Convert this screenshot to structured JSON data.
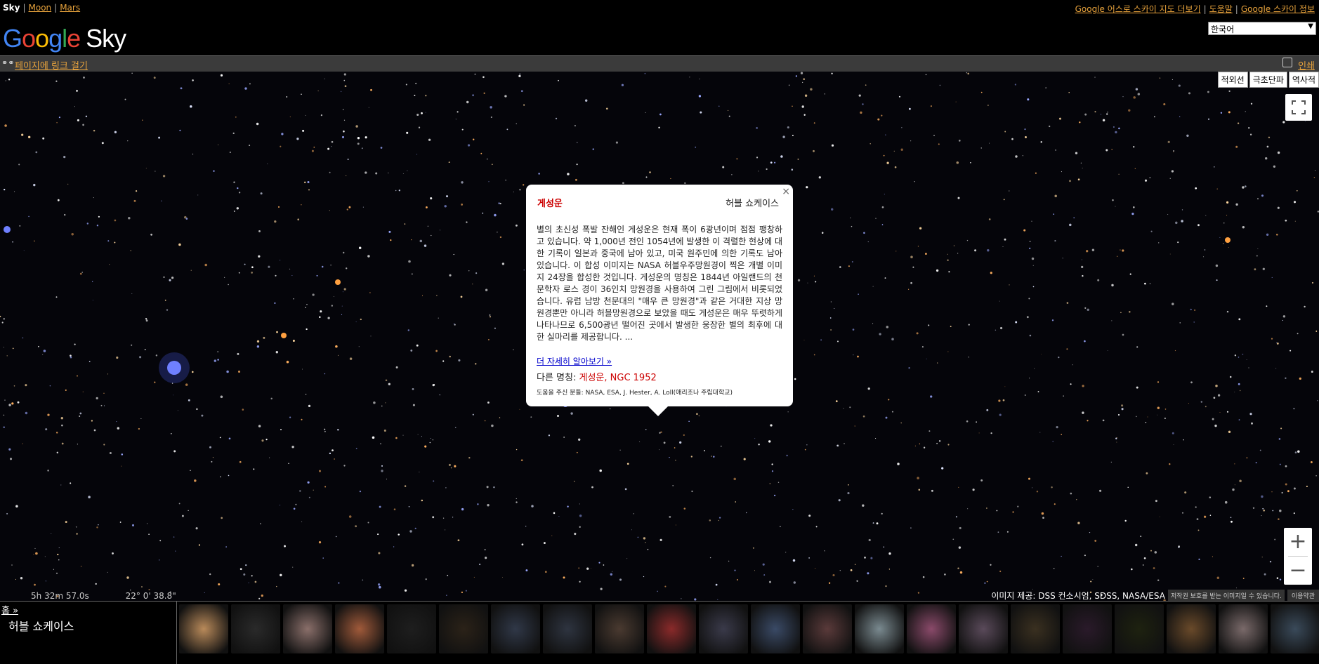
{
  "topbar": {
    "current": "Sky",
    "nav": [
      "Moon",
      "Mars"
    ],
    "links": [
      "Google 어스로 스카이 지도 더보기",
      "도움말",
      "Google 스카이 정보"
    ]
  },
  "header": {
    "logo_word": "Google",
    "logo_product": "Sky",
    "language": "한국어"
  },
  "linkbar": {
    "link_label": "페이지에 링크 걸기",
    "print_label": "인쇄"
  },
  "map": {
    "layers": [
      "적외선",
      "극초단파",
      "역사적"
    ],
    "zoom_in": "+",
    "zoom_out": "−",
    "ra": "5h 32m 57.0s",
    "dec": "22° 0' 38.8\"",
    "credit": "이미지 제공: DSS 컨소시엄, SDSS, NASA/ESA",
    "rights": "저작권 보호를 받는 이미지일 수 있습니다.",
    "terms": "이용약관"
  },
  "popup": {
    "close": "×",
    "title": "게성운",
    "collection": "허블 쇼케이스",
    "description": "별의 초신성 폭발 잔해인 게성운은 현재 폭이 6광년이며 점점 팽창하고 있습니다. 약 1,000년 전인 1054년에 발생한 이 격렬한 현상에 대한 기록이 일본과 중국에 남아 있고, 미국 원주민에 의한 기록도 남아 있습니다. 이 합성 이미지는 NASA 허블우주망원경이 찍은 개별 이미지 24장을 합성한 것입니다. 게성운의 명칭은 1844년 아일랜드의 천문학자 로스 경이 36인치 망원경을 사용하여 그린 그림에서 비롯되었습니다. 유럽 남방 천문대의 \"매우 큰 망원경\"과 같은 거대한 지상 망원경뿐만 아니라 허블망원경으로 보았을 때도 게성운은 매우 뚜렷하게 나타나므로 6,500광년 떨어진 곳에서 발생한 웅장한 별의 최후에 대한 실마리를 제공합니다. ...",
    "more": "더 자세히 알아보기 »",
    "alias_label": "다른 명칭:",
    "alias_values": "게성운, NGC 1952",
    "credit": "도움을 주신 분들: NASA, ESA, J. Hester, A. Loll(애리조나 주립대학교)"
  },
  "bottom": {
    "home": "홈 »",
    "collection": "허블 쇼케이스",
    "thumb_colors": [
      "#b98a5a",
      "#2a2a2a",
      "#8a6f6a",
      "#a05a3a",
      "#1e1e1e",
      "#2b2218",
      "#303848",
      "#2e3440",
      "#4a3a30",
      "#8a2a2a",
      "#3a3a4a",
      "#3a4a66",
      "#5a3a3a",
      "#7a8a90",
      "#8a4a6a",
      "#5a4a5a",
      "#3a3020",
      "#2a1a2a",
      "#1e2210",
      "#6a4a2a",
      "#7a6a6a",
      "#3a4a5a"
    ]
  },
  "colors": {
    "accent_link": "#e8a33c",
    "popup_title": "#cc0000"
  }
}
